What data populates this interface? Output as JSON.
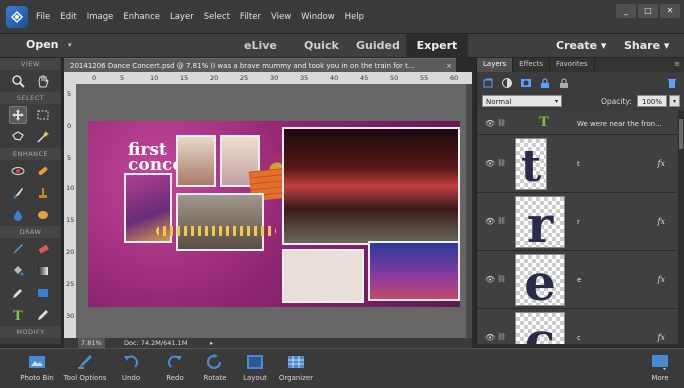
{
  "menu": [
    "File",
    "Edit",
    "Image",
    "Enhance",
    "Layer",
    "Select",
    "Filter",
    "View",
    "Window",
    "Help"
  ],
  "window_controls": {
    "minimize": "_",
    "maximize": "□",
    "close": "✕"
  },
  "modebar": {
    "open": "Open",
    "caret": "▾",
    "elive": "eLive",
    "quick": "Quick",
    "guided": "Guided",
    "expert": "Expert",
    "create": "Create ▾",
    "share": "Share ▾"
  },
  "tools": {
    "sections": {
      "view": "VIEW",
      "select": "SELECT",
      "enhance": "ENHANCE",
      "draw": "DRAW",
      "modify": "MODIFY"
    }
  },
  "document": {
    "tab_title": "20141206 Dance Concert.psd @ 7.81% (I was a brave mummy and took you in on the train for t...",
    "close": "×",
    "zoom": "7.81%",
    "doc_size": "Doc: 74.2M/641.1M",
    "page_title_line1": "first",
    "page_title_line2": "concert",
    "ruler_h": [
      "0",
      "5",
      "10",
      "15",
      "20",
      "25",
      "30",
      "35",
      "40",
      "45",
      "50",
      "55",
      "60"
    ],
    "ruler_v": [
      "5",
      "0",
      "5",
      "10",
      "15",
      "20",
      "25",
      "30"
    ]
  },
  "panel": {
    "tabs": [
      "Layers",
      "Effects",
      "Favorites"
    ],
    "blend_mode": "Normal",
    "opacity_label": "Opacity:",
    "opacity_value": "100%",
    "layers": [
      {
        "thumb": "T",
        "name": "We were near the fron...",
        "fx": ""
      },
      {
        "thumb": "t",
        "name": "t",
        "fx": "fx"
      },
      {
        "thumb": "r",
        "name": "r",
        "fx": "fx"
      },
      {
        "thumb": "e",
        "name": "e",
        "fx": "fx"
      },
      {
        "thumb": "c",
        "name": "c",
        "fx": "fx"
      }
    ]
  },
  "taskbar": {
    "photo_bin": "Photo Bin",
    "tool_options": "Tool Options",
    "undo": "Undo",
    "redo": "Redo",
    "rotate": "Rotate",
    "layout": "Layout",
    "organizer": "Organizer",
    "more": "More"
  },
  "colors": {
    "accent": "#3a7fd0",
    "page_magenta": "#8d2470",
    "chrome": "#3c3c3c"
  }
}
